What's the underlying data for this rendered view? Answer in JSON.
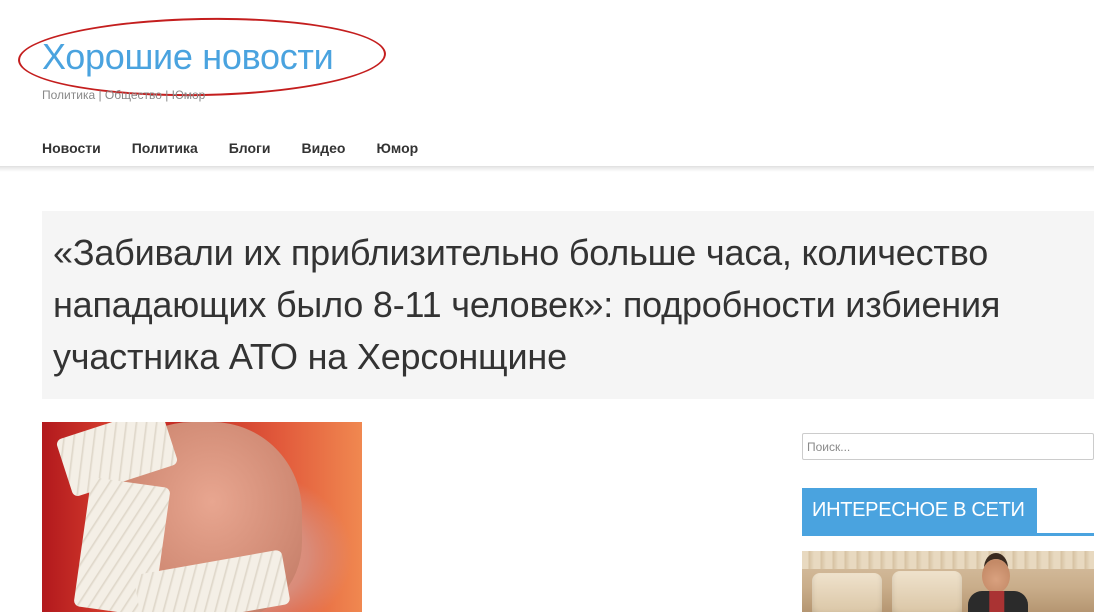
{
  "site": {
    "title": "Хорошие новости",
    "tagline": "Политика | Общество | Юмор"
  },
  "nav": {
    "items": [
      "Новости",
      "Политика",
      "Блоги",
      "Видео",
      "Юмор"
    ]
  },
  "article": {
    "headline": "«Забивали их приблизительно больше часа, количество нападающих было 8-11 человек»: подробности избиения участника АТО на Херсонщине"
  },
  "sidebar": {
    "search_placeholder": "Поиск...",
    "widget_title": "ИНТЕРЕСНОЕ В СЕТИ"
  },
  "colors": {
    "brand": "#4aa3df",
    "annotation_oval": "#c41e1e",
    "headline_bg": "#f5f5f5",
    "text": "#333333"
  }
}
